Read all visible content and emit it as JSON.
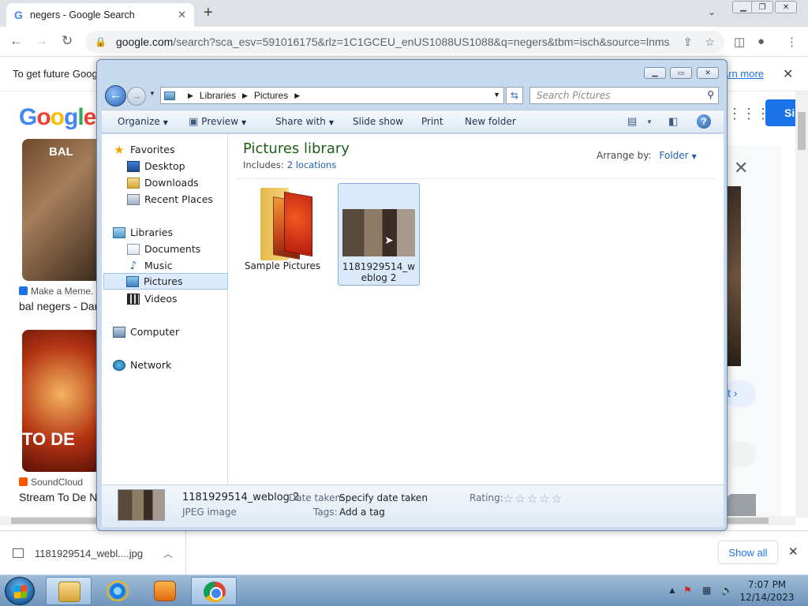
{
  "browser": {
    "tab_title": "negers - Google Search",
    "tab_favicon": "G",
    "url_host": "google.com",
    "url_rest": "/search?sca_esv=591016175&rlz=1C1GCEU_enUS1088US1088&q=negers&tbm=isch&source=lnms...",
    "infobar_message": "To get future Goog",
    "infobar_link": "arn more"
  },
  "google": {
    "logo": [
      "G",
      "o",
      "o",
      "g",
      "l",
      "e"
    ],
    "signin_label": "Si",
    "tile1_overlay": "BAL",
    "tile1_source": "Make a Meme.",
    "tile1_title": "bal negers - Dar",
    "tile2_overlay": "TO DE",
    "tile2_source": "SoundCloud",
    "tile2_title": "Stream To De N",
    "side_button": "t ›"
  },
  "explorer": {
    "breadcrumb": [
      "Libraries",
      "Pictures"
    ],
    "search_placeholder": "Search Pictures",
    "toolbar": {
      "organize": "Organize",
      "preview": "Preview",
      "share_with": "Share with",
      "slide_show": "Slide show",
      "print": "Print",
      "new_folder": "New folder"
    },
    "nav": {
      "favorites": "Favorites",
      "desktop": "Desktop",
      "downloads": "Downloads",
      "recent_places": "Recent Places",
      "libraries": "Libraries",
      "documents": "Documents",
      "music": "Music",
      "pictures": "Pictures",
      "videos": "Videos",
      "computer": "Computer",
      "network": "Network"
    },
    "library_title": "Pictures library",
    "includes_label": "Includes:",
    "includes_link": "2 locations",
    "arrange_label": "Arrange by:",
    "arrange_value": "Folder",
    "items": [
      {
        "name": "Sample Pictures",
        "type": "folder"
      },
      {
        "name": "1181929514_weblog 2",
        "type": "image",
        "selected": true
      }
    ],
    "details": {
      "filename": "1181929514_weblog 2",
      "filetype": "JPEG image",
      "date_label": "Date taken:",
      "date_value": "Specify date taken",
      "tags_label": "Tags:",
      "tags_value": "Add a tag",
      "rating_label": "Rating:",
      "rating_stars": "☆☆☆☆☆"
    }
  },
  "downloads": {
    "file_name": "1181929514_webl....jpg",
    "show_all": "Show all"
  },
  "taskbar": {
    "time": "7:07 PM",
    "date": "12/14/2023"
  }
}
